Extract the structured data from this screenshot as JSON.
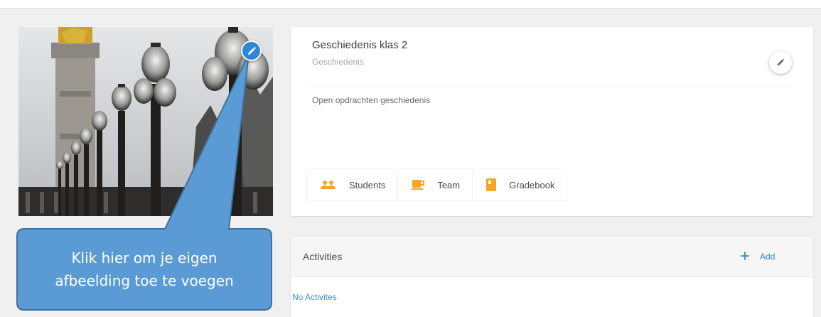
{
  "colors": {
    "accent": "#2f86d6",
    "callout_fill": "#5b9bd5",
    "callout_border": "#41719c",
    "tab_icon_orange": "#f5a623"
  },
  "photo": {
    "edit_icon": "pencil-icon"
  },
  "callout": {
    "line1": "Klik hier om je eigen",
    "line2": "afbeelding toe te voegen"
  },
  "class_card": {
    "title": "Geschiedenis klas 2",
    "subject": "Geschiedenis",
    "description": "Open opdrachten geschiedenis",
    "edit_icon": "pencil-icon",
    "tabs": [
      {
        "label": "Students",
        "icon": "students-icon"
      },
      {
        "label": "Team",
        "icon": "team-icon"
      },
      {
        "label": "Gradebook",
        "icon": "gradebook-icon"
      }
    ]
  },
  "activities": {
    "title": "Activities",
    "add_label": "Add",
    "add_icon": "plus-icon",
    "empty_text": "No Activites"
  }
}
